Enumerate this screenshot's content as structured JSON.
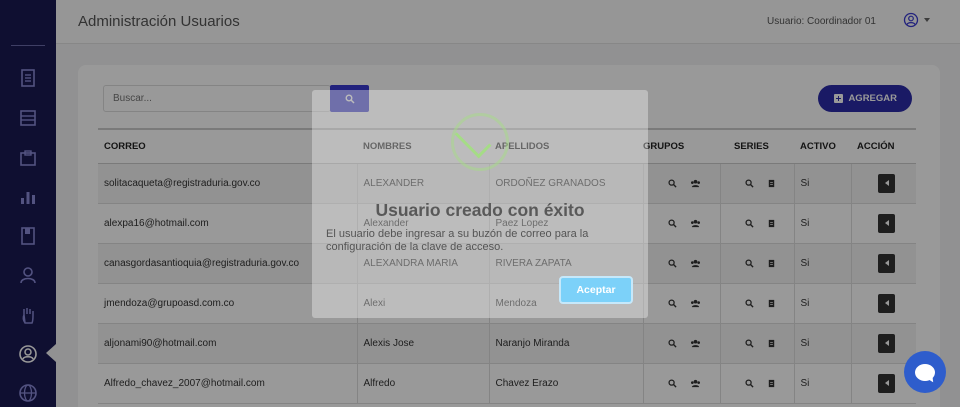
{
  "header": {
    "title": "Administración Usuarios",
    "user_label": "Usuario: Coordinador 01"
  },
  "sidebar": {
    "items": [
      {
        "icon": "document-icon"
      },
      {
        "icon": "list-icon"
      },
      {
        "icon": "folder-icon"
      },
      {
        "icon": "bar-chart-icon"
      },
      {
        "icon": "book-icon"
      },
      {
        "icon": "user-icon"
      },
      {
        "icon": "hand-icon"
      },
      {
        "icon": "user-circle-icon",
        "active": true
      },
      {
        "icon": "globe-icon"
      }
    ]
  },
  "toolbar": {
    "search_placeholder": "Buscar...",
    "add_label": "AGREGAR"
  },
  "table": {
    "columns": [
      "CORREO",
      "NOMBRES",
      "APELLIDOS",
      "GRUPOS",
      "SERIES",
      "ACTIVO",
      "ACCIÓN"
    ],
    "rows": [
      {
        "correo": "solitacaqueta@registraduria.gov.co",
        "nombres": "ALEXANDER",
        "apellidos": "ORDOÑEZ GRANADOS",
        "activo": "Si"
      },
      {
        "correo": "alexpa16@hotmail.com",
        "nombres": "Alexander",
        "apellidos": "Paez Lopez",
        "activo": "Si"
      },
      {
        "correo": "canasgordasantioquia@registraduria.gov.co",
        "nombres": "ALEXANDRA MARIA",
        "apellidos": "RIVERA ZAPATA",
        "activo": "Si"
      },
      {
        "correo": "jmendoza@grupoasd.com.co",
        "nombres": "Alexi",
        "apellidos": "Mendoza",
        "activo": "Si"
      },
      {
        "correo": "aljonami90@hotmail.com",
        "nombres": "Alexis Jose",
        "apellidos": "Naranjo Miranda",
        "activo": "Si"
      },
      {
        "correo": "Alfredo_chavez_2007@hotmail.com",
        "nombres": "Alfredo",
        "apellidos": "Chavez Erazo",
        "activo": "Si"
      }
    ]
  },
  "modal": {
    "title": "Usuario creado con éxito",
    "text": "El usuario debe ingresar a su buzón de correo para la configuración de la clave de acceso.",
    "ok_label": "Aceptar"
  },
  "colors": {
    "sidebar": "#1a1a52",
    "primary": "#2c2ca8",
    "success": "#a5dc86",
    "confirm": "#7cd1f9",
    "chat": "#2e5dcc"
  }
}
